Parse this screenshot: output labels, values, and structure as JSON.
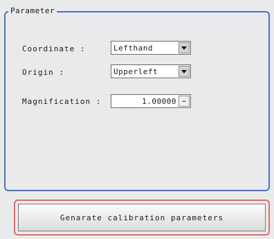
{
  "group": {
    "title": "Parameter"
  },
  "coordinate": {
    "label": "Coordinate :",
    "value": "Lefthand"
  },
  "origin": {
    "label": "Origin :",
    "value": "Upperleft"
  },
  "magnification": {
    "label": "Magnification :",
    "value": "1.00000",
    "button": "…"
  },
  "action": {
    "label": "Genarate calibration parameters"
  },
  "icons": {
    "dropdown": "chevron-down-icon",
    "more": "ellipsis-icon"
  },
  "colors": {
    "group_border": "#4c72c4",
    "highlight_border": "#e56a6a",
    "panel_bg": "#e8eaec"
  }
}
